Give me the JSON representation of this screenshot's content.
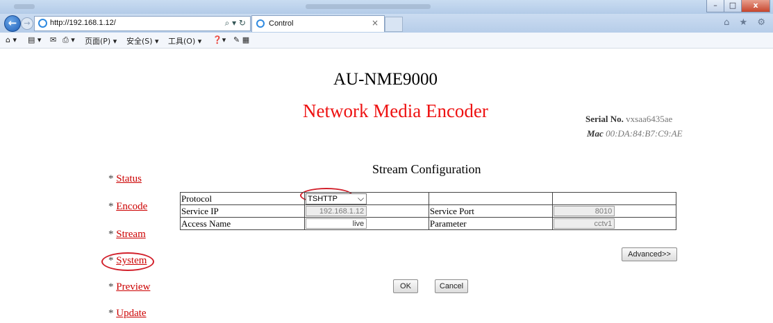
{
  "browser": {
    "url": "http://192.168.1.12/",
    "search_refresh": "⌕ ▾ ↻",
    "tab_title": "Control",
    "tab_close": "×",
    "window_buttons": [
      "–",
      "□",
      "x"
    ],
    "right_icons": "⌂ ★ ⚙",
    "command_bar": {
      "home": "⌂ ▾",
      "feeds": "▤ ▾",
      "mail": "✉",
      "print": "⎙ ▾",
      "page": "页面(P) ▾",
      "safety": "安全(S) ▾",
      "tools": "工具(O) ▾",
      "help": "❓▾",
      "extra": "✎ ▦"
    }
  },
  "header": {
    "title": "AU-NME9000",
    "subtitle": "Network Media Encoder",
    "serial_label": "Serial No.",
    "serial_value": "vxsaa6435ae",
    "mac_label": "Mac",
    "mac_value": "00:DA:84:B7:C9:AE"
  },
  "nav": {
    "bullet": "*",
    "items": [
      "Status",
      "Encode",
      "Stream",
      "System",
      "Preview",
      "Update"
    ]
  },
  "stream": {
    "title": "Stream Configuration",
    "protocol_label": "Protocol",
    "protocol_value": "TSHTTP",
    "service_ip_label": "Service IP",
    "service_ip_value": "192.168.1.12",
    "service_port_label": "Service Port",
    "service_port_value": "8010",
    "access_name_label": "Access Name",
    "access_name_value": "live",
    "parameter_label": "Parameter",
    "parameter_value": "cctv1"
  },
  "buttons": {
    "advanced": "Advanced>>",
    "ok": "OK",
    "cancel": "Cancel"
  },
  "colors": {
    "annotation_circle": "#d2202b",
    "link": "#cc0000",
    "subtitle": "#ee1111"
  }
}
